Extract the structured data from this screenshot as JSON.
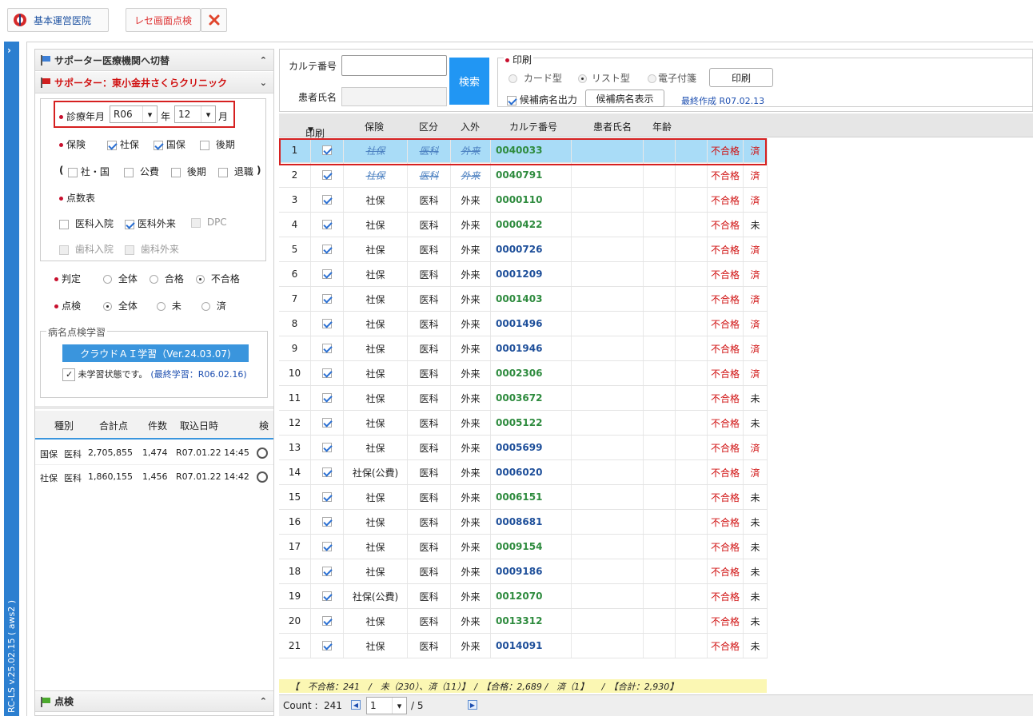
{
  "toolbar": {
    "kihon_label": "基本運営医院",
    "check_label": "レセ画面点検"
  },
  "sidebar_version": "RC-LS v.25.02.15 ( aws2 )",
  "left": {
    "switch_header": "サポーター医療機関へ切替",
    "clinic_header": "サポーター：東小金井さくらクリニック",
    "shinryo_label": "診療年月",
    "year_value": "R06",
    "year_unit": "年",
    "month_value": "12",
    "month_unit": "月",
    "hoken_label": "保険",
    "shaho": "社保",
    "kokuho": "国保",
    "kouki": "後期",
    "paren_open": "(",
    "sha_koku": "社・国",
    "kouhi": "公費",
    "kouki2": "後期",
    "taishoku": "退職",
    "paren_close": ")",
    "tensu_label": "点数表",
    "ika_nyuin": "医科入院",
    "ika_gairai": "医科外来",
    "dpc": "DPC",
    "shika_nyuin": "歯科入院",
    "shika_gairai": "歯科外来",
    "hantei_label": "判定",
    "all1": "全体",
    "goukaku": "合格",
    "fugoukaku": "不合格",
    "tenken_label": "点検",
    "all2": "全体",
    "mi": "未",
    "zumi": "済",
    "learn_legend": "病名点検学習",
    "cloud_btn": "クラウドＡＩ学習（Ver.24.03.07)",
    "unlearned": "未学習状態です。",
    "last_learn": "(最終学習：R06.02.16)",
    "summary_headers": [
      "種別",
      "合計点",
      "件数",
      "取込日時",
      "検"
    ],
    "summary_rows": [
      {
        "t1": "国保",
        "t2": "医科",
        "total": "2,705,855",
        "count": "1,474",
        "date": "R07.01.22 14:45"
      },
      {
        "t1": "社保",
        "t2": "医科",
        "total": "1,860,155",
        "count": "1,456",
        "date": "R07.01.22 14:42"
      }
    ],
    "bottom_header": "点検"
  },
  "search": {
    "karte_label": "カルテ番号",
    "patient_label": "患者氏名",
    "search_btn": "検索",
    "print_legend": "印刷",
    "card": "カード型",
    "list": "リスト型",
    "denshi": "電子付箋",
    "print_btn": "印刷",
    "kouho_out": "候補病名出力",
    "kouho_show": "候補病名表示",
    "last_made": "最終作成 R07.02.13"
  },
  "grid": {
    "headers": [
      "印刷",
      "保険",
      "区分",
      "入外",
      "カルテ番号",
      "患者氏名",
      "年齢"
    ],
    "rows": [
      {
        "n": "1",
        "hoken": "社保",
        "kubun": "医科",
        "nyugai": "外来",
        "karte": "0040033",
        "kc": "g",
        "res": "不合格",
        "st": "済",
        "strike": true
      },
      {
        "n": "2",
        "hoken": "社保",
        "kubun": "医科",
        "nyugai": "外来",
        "karte": "0040791",
        "kc": "g",
        "res": "不合格",
        "st": "済",
        "strike": true
      },
      {
        "n": "3",
        "hoken": "社保",
        "kubun": "医科",
        "nyugai": "外来",
        "karte": "0000110",
        "kc": "g",
        "res": "不合格",
        "st": "済"
      },
      {
        "n": "4",
        "hoken": "社保",
        "kubun": "医科",
        "nyugai": "外来",
        "karte": "0000422",
        "kc": "g",
        "res": "不合格",
        "st": "未"
      },
      {
        "n": "5",
        "hoken": "社保",
        "kubun": "医科",
        "nyugai": "外来",
        "karte": "0000726",
        "kc": "b",
        "res": "不合格",
        "st": "済"
      },
      {
        "n": "6",
        "hoken": "社保",
        "kubun": "医科",
        "nyugai": "外来",
        "karte": "0001209",
        "kc": "b",
        "res": "不合格",
        "st": "済"
      },
      {
        "n": "7",
        "hoken": "社保",
        "kubun": "医科",
        "nyugai": "外来",
        "karte": "0001403",
        "kc": "g",
        "res": "不合格",
        "st": "済"
      },
      {
        "n": "8",
        "hoken": "社保",
        "kubun": "医科",
        "nyugai": "外来",
        "karte": "0001496",
        "kc": "b",
        "res": "不合格",
        "st": "済"
      },
      {
        "n": "9",
        "hoken": "社保",
        "kubun": "医科",
        "nyugai": "外来",
        "karte": "0001946",
        "kc": "b",
        "res": "不合格",
        "st": "済"
      },
      {
        "n": "10",
        "hoken": "社保",
        "kubun": "医科",
        "nyugai": "外来",
        "karte": "0002306",
        "kc": "g",
        "res": "不合格",
        "st": "済"
      },
      {
        "n": "11",
        "hoken": "社保",
        "kubun": "医科",
        "nyugai": "外来",
        "karte": "0003672",
        "kc": "g",
        "res": "不合格",
        "st": "未"
      },
      {
        "n": "12",
        "hoken": "社保",
        "kubun": "医科",
        "nyugai": "外来",
        "karte": "0005122",
        "kc": "g",
        "res": "不合格",
        "st": "未"
      },
      {
        "n": "13",
        "hoken": "社保",
        "kubun": "医科",
        "nyugai": "外来",
        "karte": "0005699",
        "kc": "b",
        "res": "不合格",
        "st": "済"
      },
      {
        "n": "14",
        "hoken": "社保(公費)",
        "kubun": "医科",
        "nyugai": "外来",
        "karte": "0006020",
        "kc": "b",
        "res": "不合格",
        "st": "済"
      },
      {
        "n": "15",
        "hoken": "社保",
        "kubun": "医科",
        "nyugai": "外来",
        "karte": "0006151",
        "kc": "g",
        "res": "不合格",
        "st": "未"
      },
      {
        "n": "16",
        "hoken": "社保",
        "kubun": "医科",
        "nyugai": "外来",
        "karte": "0008681",
        "kc": "b",
        "res": "不合格",
        "st": "未"
      },
      {
        "n": "17",
        "hoken": "社保",
        "kubun": "医科",
        "nyugai": "外来",
        "karte": "0009154",
        "kc": "g",
        "res": "不合格",
        "st": "未"
      },
      {
        "n": "18",
        "hoken": "社保",
        "kubun": "医科",
        "nyugai": "外来",
        "karte": "0009186",
        "kc": "b",
        "res": "不合格",
        "st": "未"
      },
      {
        "n": "19",
        "hoken": "社保(公費)",
        "kubun": "医科",
        "nyugai": "外来",
        "karte": "0012070",
        "kc": "g",
        "res": "不合格",
        "st": "未"
      },
      {
        "n": "20",
        "hoken": "社保",
        "kubun": "医科",
        "nyugai": "外来",
        "karte": "0013312",
        "kc": "g",
        "res": "不合格",
        "st": "未"
      },
      {
        "n": "21",
        "hoken": "社保",
        "kubun": "医科",
        "nyugai": "外来",
        "karte": "0014091",
        "kc": "b",
        "res": "不合格",
        "st": "未"
      }
    ]
  },
  "footer": {
    "stats": "【　不合格：241　/　未（230）、済（11）】　/　【合格：2,689 /　済（1】　　/　【合計：2,930】",
    "count_label": "Count :",
    "count_value": "241",
    "page_value": "1",
    "page_total": "/ 5"
  },
  "colors": {
    "accent": "#2c7fd0",
    "highlight": "#a9dcf7",
    "search_btn": "#2196f3",
    "ng": "#d01010",
    "stats_bg": "#fbf7b3"
  }
}
